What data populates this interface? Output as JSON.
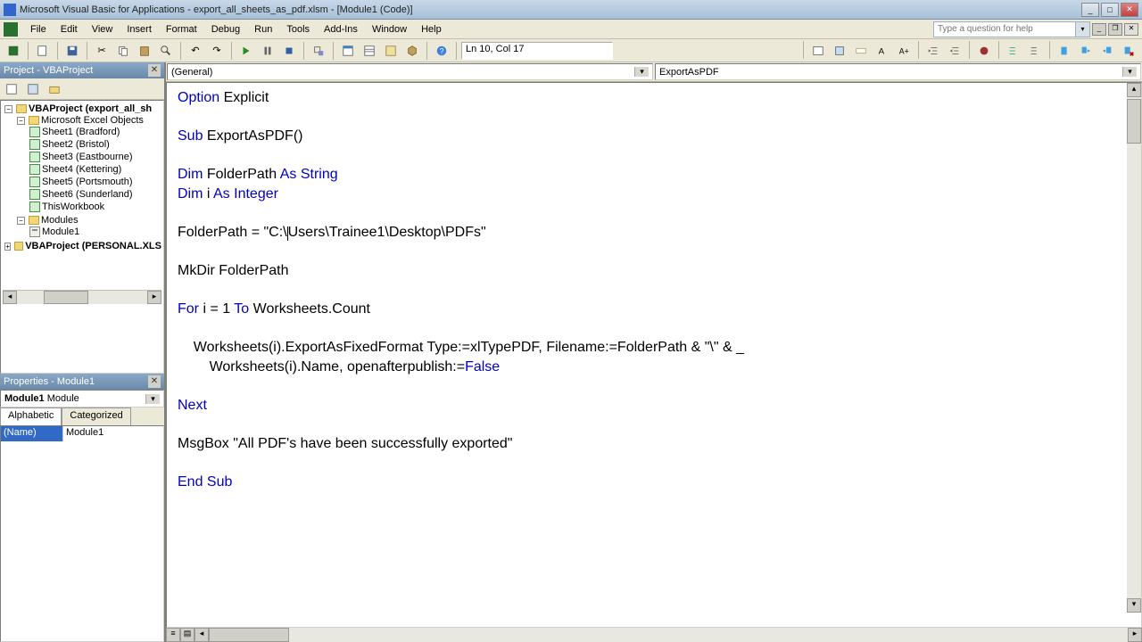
{
  "titlebar": {
    "title": "Microsoft Visual Basic for Applications - export_all_sheets_as_pdf.xlsm - [Module1 (Code)]"
  },
  "menu": {
    "items": [
      "File",
      "Edit",
      "View",
      "Insert",
      "Format",
      "Debug",
      "Run",
      "Tools",
      "Add-Ins",
      "Window",
      "Help"
    ],
    "question_placeholder": "Type a question for help"
  },
  "toolbar": {
    "linecol": "Ln 10, Col 17"
  },
  "project_panel": {
    "title": "Project - VBAProject",
    "root1": "VBAProject (export_all_sh",
    "objects_folder": "Microsoft Excel Objects",
    "sheets": [
      "Sheet1 (Bradford)",
      "Sheet2 (Bristol)",
      "Sheet3 (Eastbourne)",
      "Sheet4 (Kettering)",
      "Sheet5 (Portsmouth)",
      "Sheet6 (Sunderland)"
    ],
    "thisworkbook": "ThisWorkbook",
    "modules_folder": "Modules",
    "module1": "Module1",
    "root2": "VBAProject (PERSONAL.XLS"
  },
  "properties_panel": {
    "title": "Properties - Module1",
    "object_name": "Module1",
    "object_type": "Module",
    "tab_alpha": "Alphabetic",
    "tab_cat": "Categorized",
    "name_key": "(Name)",
    "name_val": "Module1"
  },
  "code": {
    "object_combo": "(General)",
    "proc_combo": "ExportAsPDF",
    "lines": {
      "l1a": "Option",
      "l1b": " Explicit",
      "l2a": "Sub",
      "l2b": " ExportAsPDF()",
      "l3a": "Dim",
      "l3b": " FolderPath ",
      "l3c": "As",
      "l3d": " ",
      "l3e": "String",
      "l4a": "Dim",
      "l4b": " i ",
      "l4c": "As",
      "l4d": " ",
      "l4e": "Integer",
      "l5a": "FolderPath = ",
      "l5b": "\"C:\\",
      "l5c": "Users\\Trainee1\\Desktop\\PDFs\"",
      "l6": "MkDir FolderPath",
      "l7a": "For",
      "l7b": " i = 1 ",
      "l7c": "To",
      "l7d": " Worksheets.Count",
      "l8a": "    Worksheets(i).ExportAsFixedFormat Type:=xlTypePDF, Filename:=FolderPath & \"\\\" & _",
      "l8b": "        Worksheets(i).Name, openafterpublish:=",
      "l8c": "False",
      "l9": "Next",
      "l10a": "MsgBox ",
      "l10b": "\"All PDF's have been successfully exported\"",
      "l11a": "End",
      "l11b": " ",
      "l11c": "Sub"
    }
  }
}
